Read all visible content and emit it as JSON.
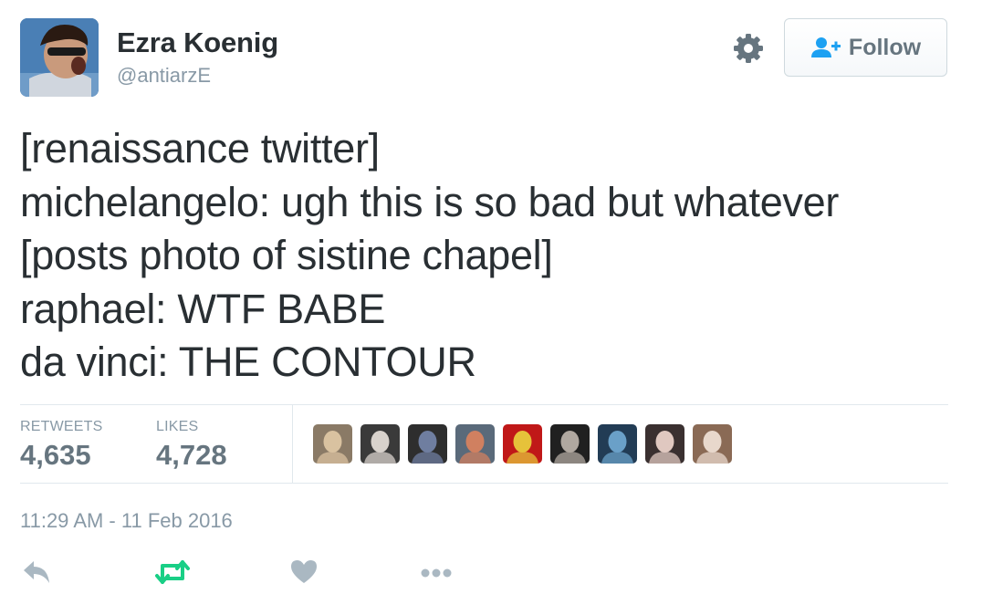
{
  "author": {
    "display_name": "Ezra Koenig",
    "handle": "@antiarzE"
  },
  "header": {
    "follow_label": "Follow",
    "icons": [
      "gear-icon",
      "follow-user-icon"
    ]
  },
  "tweet": {
    "lines": [
      "[renaissance twitter]",
      "michelangelo: ugh this is so bad but whatever",
      "[posts photo of sistine chapel]",
      "raphael: WTF BABE",
      "da vinci: THE CONTOUR"
    ]
  },
  "stats": {
    "retweets_label": "RETWEETS",
    "retweets_value": "4,635",
    "likes_label": "LIKES",
    "likes_value": "4,728"
  },
  "likers": [
    {
      "colors": [
        "#8a7a66",
        "#d9c2a0"
      ]
    },
    {
      "colors": [
        "#3a3a3a",
        "#d8d2cc"
      ]
    },
    {
      "colors": [
        "#2e2e2e",
        "#6f7ea0"
      ]
    },
    {
      "colors": [
        "#5a6a7a",
        "#d08060"
      ]
    },
    {
      "colors": [
        "#c01818",
        "#e6c23a"
      ]
    },
    {
      "colors": [
        "#202020",
        "#b0a8a0"
      ]
    },
    {
      "colors": [
        "#223c55",
        "#6aa0c8"
      ]
    },
    {
      "colors": [
        "#3a3030",
        "#e0c8c0"
      ]
    },
    {
      "colors": [
        "#8a6a55",
        "#e8d8cc"
      ]
    }
  ],
  "timestamp": "11:29 AM - 11 Feb 2016",
  "actions": [
    "reply-icon",
    "retweet-icon",
    "like-icon",
    "more-icon"
  ],
  "colors": {
    "text": "#292f33",
    "muted": "#8899a6",
    "stat": "#66757f",
    "retweet_green": "#19cf86",
    "icon_gray": "#aab8c2",
    "follow_blue": "#1da1f2",
    "divider": "#e1e8ed"
  }
}
